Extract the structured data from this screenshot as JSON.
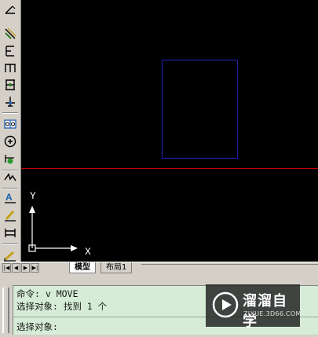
{
  "toolbar": {
    "tools": [
      {
        "name": "dimension-tool-icon"
      },
      {
        "name": "aligned-dimension-icon"
      },
      {
        "name": "ordinate-dimension-icon"
      },
      {
        "name": "linear-dimension-icon"
      },
      {
        "name": "baseline-dimension-icon"
      },
      {
        "name": "continue-dimension-icon"
      },
      {
        "name": "tolerance-icon"
      },
      {
        "name": "center-mark-icon"
      },
      {
        "name": "dimension-edit-icon"
      },
      {
        "name": "jogged-dimension-icon"
      },
      {
        "name": "text-style-icon"
      },
      {
        "name": "dimension-text-edit-icon"
      },
      {
        "name": "dimension-update-icon"
      },
      {
        "name": "dimension-style-icon"
      }
    ]
  },
  "canvas": {
    "background": "#000000",
    "crosshair_color": "#c00000",
    "rectangle_color": "#1e1ea0",
    "ucs": {
      "x_label": "X",
      "y_label": "Y"
    }
  },
  "tabs": {
    "items": [
      {
        "label": "模型",
        "active": true
      },
      {
        "label": "布局1",
        "active": false
      }
    ]
  },
  "command": {
    "lines": [
      "命令: v MOVE",
      "选择对象: 找到 1 个"
    ],
    "prompt": "选择对象:"
  },
  "watermark": {
    "title": "溜溜自学",
    "url": "ZIXUE.3D66.COM"
  }
}
